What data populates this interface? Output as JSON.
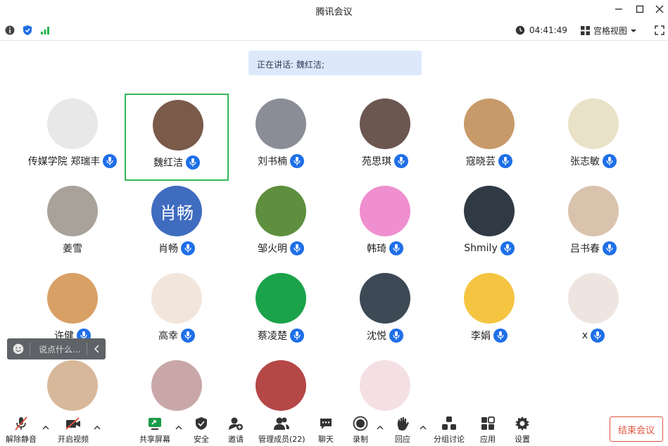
{
  "window": {
    "title": "腾讯会议"
  },
  "topbar": {
    "time": "04:41:49",
    "view_label": "宫格视图"
  },
  "speaking_banner": "正在讲话: 魏红洁;",
  "participants": [
    {
      "name": "传媒学院 郑瑞丰",
      "avatar_color": "#e8e8e8"
    },
    {
      "name": "魏红洁",
      "avatar_color": "#7a5a48"
    },
    {
      "name": "刘书楠",
      "avatar_color": "#8a8c96"
    },
    {
      "name": "苑思琪",
      "avatar_color": "#6b5650"
    },
    {
      "name": "寇晓芸",
      "avatar_color": "#c89a6a"
    },
    {
      "name": "张志敏",
      "avatar_color": "#e9e2c8"
    },
    {
      "name": "姜雪",
      "avatar_color": "#a8a29a"
    },
    {
      "name": "肖畅",
      "avatar_color": "#3f6cbf",
      "avatar_text": "肖畅"
    },
    {
      "name": "邹火明",
      "avatar_color": "#5d8f3e"
    },
    {
      "name": "韩琦",
      "avatar_color": "#ef8fcf"
    },
    {
      "name": "Shmily",
      "avatar_color": "#2f3a44"
    },
    {
      "name": "吕书春",
      "avatar_color": "#d9c3ad"
    },
    {
      "name": "许健",
      "avatar_color": "#d9a066"
    },
    {
      "name": "高幸",
      "avatar_color": "#f2e6dc"
    },
    {
      "name": "蔡凌楚",
      "avatar_color": "#1aa34a"
    },
    {
      "name": "沈悦",
      "avatar_color": "#3d4a55"
    },
    {
      "name": "李娟",
      "avatar_color": "#f5c542"
    },
    {
      "name": "x",
      "avatar_color": "#efe5e0"
    },
    {
      "name": "",
      "avatar_color": "#d8b89a"
    },
    {
      "name": "",
      "avatar_color": "#c9a7a8"
    },
    {
      "name": "",
      "avatar_color": "#b54747"
    },
    {
      "name": "",
      "avatar_color": "#f4e0e4"
    }
  ],
  "chat": {
    "placeholder": "说点什么..."
  },
  "toolbar": {
    "unmute": "解除静音",
    "video": "开启视频",
    "share": "共享屏幕",
    "security": "安全",
    "invite": "邀请",
    "members": "管理成员(22)",
    "chat": "聊天",
    "record": "录制",
    "react": "回应",
    "breakout": "分组讨论",
    "apps": "应用",
    "settings": "设置",
    "end": "结束会议"
  },
  "colors": {
    "accent": "#1e6fe8",
    "active_border": "#35b85a",
    "end": "#e0533d",
    "banner_bg": "#dde9fb"
  }
}
